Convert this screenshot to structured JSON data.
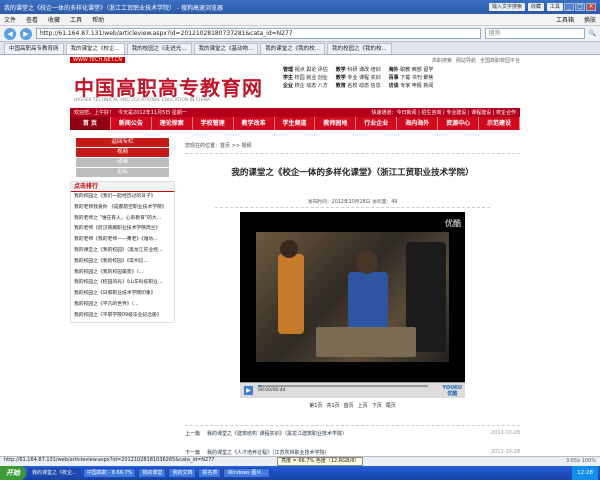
{
  "browser": {
    "window_title": "我的课堂之《校企一体的多样化课堂》（浙江工贸职业技术学院） - 搜狗高速浏览器",
    "title_right": [
      "输入文字搜索",
      "收藏",
      "工具"
    ],
    "menu": [
      "文件",
      "查看",
      "收藏",
      "工具",
      "帮助"
    ],
    "menu_right": [
      "工具箱",
      "换肤"
    ],
    "url": "http://61.164.87.131/web/articleview.aspx?id=20121028180737281&cata_id=N277",
    "search_placeholder": "搜狗",
    "tabs": [
      "中国高职高专教育网",
      "我的课堂之《校企...",
      "我的校园之《走进光...",
      "我的课堂之《基动物...",
      "我的课堂之《我的校...",
      "我的校园之《我的校..."
    ]
  },
  "site": {
    "url_badge": "WWW.TECH.NET.CN",
    "top_links": [
      "高职搜索",
      "网站导航",
      "全国高职校园平台"
    ],
    "logo": "中国高职高专教育网",
    "logo_en": "HIGHER TECHNICAL AND VOCATIONAL EDUCATION IN CHINA",
    "header_links": [
      {
        "lead": "管理",
        "items": "视点 舆论 评估"
      },
      {
        "lead": "教学",
        "items": "科研 课改 培训"
      },
      {
        "lead": "海外",
        "items": "职教 西部 留学"
      },
      {
        "lead": "学生",
        "items": "校园 就业 创业"
      },
      {
        "lead": "教学",
        "items": "专业 课程 实训"
      },
      {
        "lead": "百事",
        "items": "下载 书刊 聚焦"
      },
      {
        "lead": "企业",
        "items": "校企 动态 八方"
      },
      {
        "lead": "教育",
        "items": "名校 动态 信息"
      },
      {
        "lead": "访谈",
        "items": "专家 申报 新闻"
      }
    ],
    "welcome": "欢迎您，上午好！",
    "date": "今天是2012年11月5日 星期一",
    "quick": "快速通道：今日新闻 | 招生咨询 | 专业建设 | 课程建设 | 校企合作",
    "nav": [
      "首 页",
      "新闻公告",
      "理论探索",
      "学校管理",
      "教学改革",
      "学生频道",
      "教师园地",
      "行业企业",
      "海内海外",
      "资源中心",
      "示范建设"
    ],
    "side_buttons": [
      {
        "label": "返回专栏",
        "style": "red"
      },
      {
        "label": "视频",
        "style": "red"
      },
      {
        "label": "动画",
        "style": "gray"
      },
      {
        "label": "论坛",
        "style": "gray"
      }
    ],
    "rank_title": "点击排行",
    "rank_items": [
      "我的校园之《我们一起经历过的日子》",
      "我的老师我爱你 《成都航空职业技术学院》",
      "我的老师之 \"谁在育人，心系教育\"的大...",
      "我的老师《武汉铁路职业技术学院周兰》",
      "我的老师《我的老师——黄老》《潍坊...",
      "我的课堂之《我的校园》（黑龙江农业经...",
      "我的校园之《我的校园》《常州信...",
      "我的校园之《我的校园美景》（...",
      "我的校园之《校园风光》《山东科技职业...",
      "我的校园之《日照职业技术学院印象》",
      "我的校园之《平凡的世界》（...",
      "我的校园之《平职学院09级毕业纪念册》"
    ],
    "breadcrumb": "您现在的位置：首页 >> 视频",
    "article_title": "我的课堂之《校企一体的多样化课堂》（浙江工贸职业技术学院）",
    "meta": "发布时间：2012年10月28日  访问量：49",
    "player": {
      "brand_top": "优酷",
      "time": "00:00/06:44",
      "progress": 0.02,
      "brand_bottom": "YOUKU",
      "brand_bottom_cn": "优酷"
    },
    "pager": [
      "第1页",
      "共1页",
      "首页",
      "上页",
      "下页",
      "尾页"
    ],
    "prev": {
      "label": "上一篇",
      "text": "我的课堂之《建筑结构`课程实训》（黑龙江建筑职业技术学院）",
      "date": "2012-10-28"
    },
    "next": {
      "label": "下一篇",
      "text": "我的课堂之《人才培养过程》（江苏农林职业技术学院）",
      "date": "2012-10-28"
    }
  },
  "status": {
    "left": "http://61.164.87.131/web/articleview.aspx?id=20121028181036265&cata_id=N277",
    "tip": "亮度 = 66.7% 色度（12,RGB/8）",
    "right": "3.65x  100%"
  },
  "taskbar": {
    "start": "开始",
    "tasks": [
      "我的课堂之《校企...",
      "中国高职 - 8.66.7%",
      "我的课堂",
      "我的文档",
      "报名表",
      "Windows 图片..."
    ],
    "clock": "12:28"
  }
}
